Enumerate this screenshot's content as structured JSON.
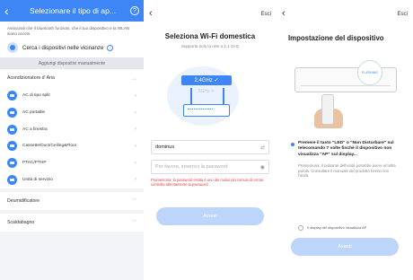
{
  "screen1": {
    "title": "Selezionare il tipo di ap...",
    "info_text": "Assicurati che il bluetooth funzioni, che il tuo dispositivo e la WLAN siano accesi.",
    "search_label": "Cerca i dispositivi nelle vicinanze",
    "manual_add": "Aggiungi dispositivi manualmente",
    "section_title": "Acondizionatore d' Aria",
    "items": [
      {
        "label": "AC di tipo split"
      },
      {
        "label": "AC portatile"
      },
      {
        "label": "AC a finestra"
      },
      {
        "label": "Cassette/Duct/Ceiling&Floor"
      },
      {
        "label": "PTAC/PTHP"
      },
      {
        "label": "Unità di servizio"
      }
    ],
    "collapsed_sections": [
      "Deumidificatore",
      "Scaldabagno"
    ]
  },
  "screen2": {
    "exit_label": "Esci",
    "title": "Seleziona Wi-Fi domestica",
    "subtitle": "Supporta solo la rete a 2,4 GHz",
    "band_24": "2.4GHz ✓",
    "band_5": "5GHz ✕",
    "ssid_value": "dominus",
    "password_placeholder": "Per favore, inserisci la password",
    "reminder": "Promemoria: la password errata è uno dei motivi più comuni di errore, controlla attentamente la password.",
    "next_button": "Avanti"
  },
  "screen3": {
    "exit_label": "Esci",
    "title": "Impostazione del dispositivo",
    "flashing_label": "FLASHING",
    "step_text": "Premere il tasto \"LED\" o \"Non Disturbare\" sul telecomando 7 volte finché il dispositivo non visualizza \"AP\" sul display...",
    "note_text": "Promemoria: Il pulsante dell'unità potrebbe avere un'altra parola. Consultare il manuale del prodotto fornito con l'unità.",
    "checkbox_label": "Il display del dispositivo visualizza AP",
    "next_button": "Avanti"
  },
  "colors": {
    "accent": "#3e86f5",
    "button_disabled": "#bdd5fb",
    "reminder_red": "#e23b3b"
  }
}
